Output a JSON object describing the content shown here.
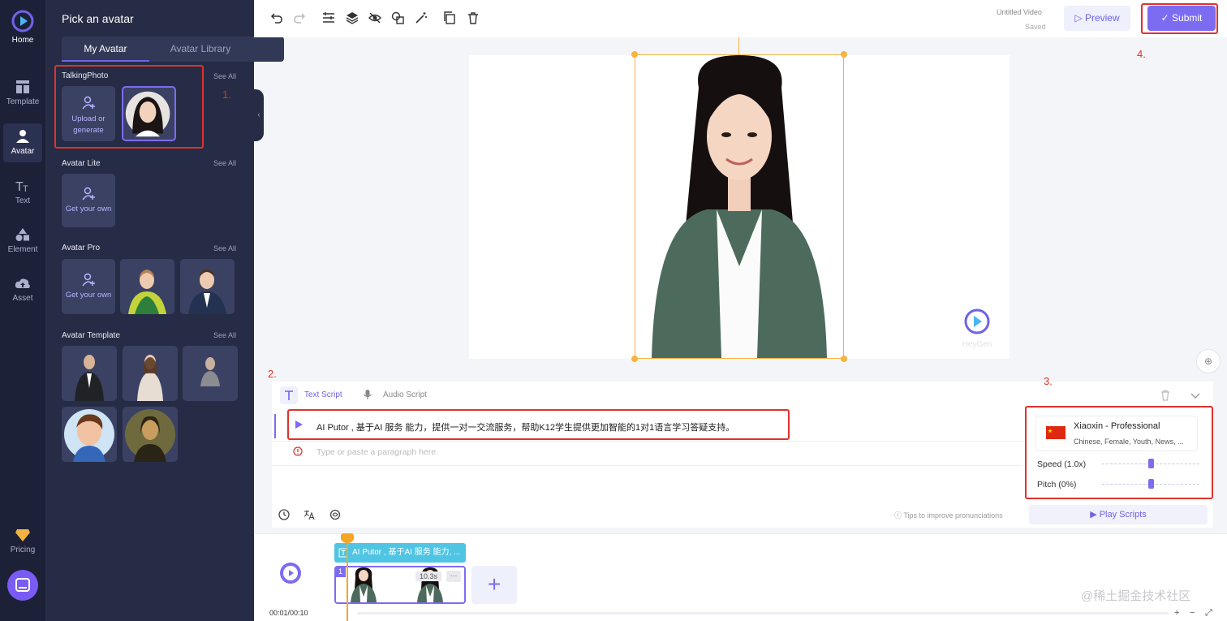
{
  "rail": {
    "home": "Home",
    "template": "Template",
    "avatar": "Avatar",
    "text": "Text",
    "element": "Element",
    "asset": "Asset",
    "pricing": "Pricing"
  },
  "panel": {
    "title": "Pick an avatar",
    "tabs": [
      "My Avatar",
      "Avatar Library"
    ],
    "see_all": "See All",
    "sections": {
      "talking_photo": "TalkingPhoto",
      "avatar_lite": "Avatar Lite",
      "avatar_pro": "Avatar Pro",
      "avatar_template": "Avatar Template"
    },
    "upload_label": "Upload or generate",
    "get_your_own": "Get your own"
  },
  "annotations": [
    "1.",
    "2.",
    "3.",
    "4."
  ],
  "toolbar": {
    "video_title": "Untitled Video",
    "saved": "Saved",
    "preview": "Preview",
    "submit": "Submit"
  },
  "canvas": {
    "watermark": "HeyGen"
  },
  "script": {
    "text_tab": "Text Script",
    "audio_tab": "Audio Script",
    "line1": "AI Putor , 基于AI 服务 能力，提供一对一交流服务，帮助K12学生提供更加智能的1对1语言学习答疑支持。",
    "placeholder": "Type or paste a paragraph here.",
    "tips": "Tips to improve pronunciations",
    "play_scripts": "Play Scripts"
  },
  "voice": {
    "name": "Xiaoxin - Professional",
    "desc": "Chinese, Female, Youth, News, ...",
    "speed_label": "Speed (1.0x)",
    "pitch_label": "Pitch (0%)",
    "speed_level": 0.5,
    "pitch_level": 0.5
  },
  "timeline": {
    "text_clip": "AI Putor , 基于AI 服务 能力, ...",
    "clip_number": "1",
    "duration": "10.3s",
    "more": "···",
    "add": "+",
    "time": "00:01/00:10",
    "zoom_in": "+",
    "zoom_out": "−",
    "expand": "⤢"
  },
  "credit": "@稀土掘金技术社区",
  "colors": {
    "accent": "#7c6cf2",
    "sidebar": "#1c2138",
    "panel": "#262c45",
    "annotation_red": "#e0322c",
    "frame_orange": "#f5b342",
    "text_clip_blue": "#50c5e3"
  }
}
